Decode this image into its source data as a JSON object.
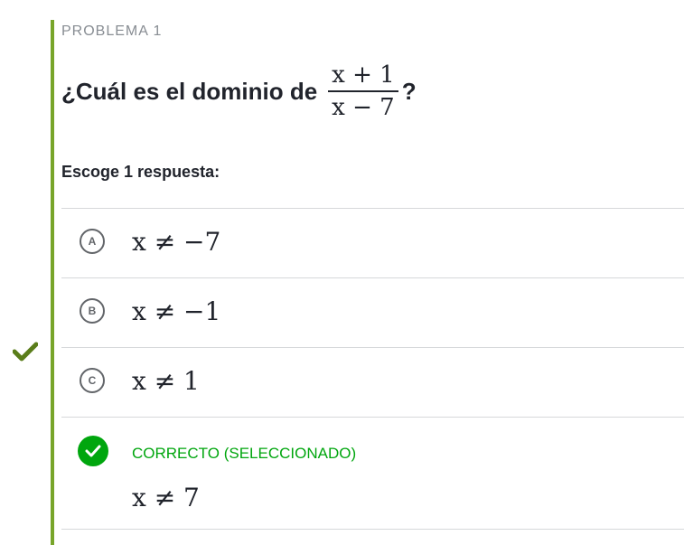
{
  "problem": {
    "label": "PROBLEMA 1",
    "question_prefix": "¿Cuál es el dominio de",
    "numerator": "x + 1",
    "denominator": "x − 7",
    "question_suffix": "?"
  },
  "instruction": "Escoge 1 respuesta:",
  "choices": [
    {
      "letter": "A",
      "math": "x ≠ −7"
    },
    {
      "letter": "B",
      "math": "x ≠ −1"
    },
    {
      "letter": "C",
      "math": "x ≠ 1"
    },
    {
      "status_label": "CORRECTO (SELECCIONADO)",
      "math": "x ≠ 7"
    }
  ],
  "colors": {
    "accent_bar": "#78a52a",
    "correct": "#00a60e",
    "side_check": "#5a7d1a"
  },
  "icons": {
    "side_indicator": "checkmark-icon",
    "correct_indicator": "check-circle-icon"
  }
}
